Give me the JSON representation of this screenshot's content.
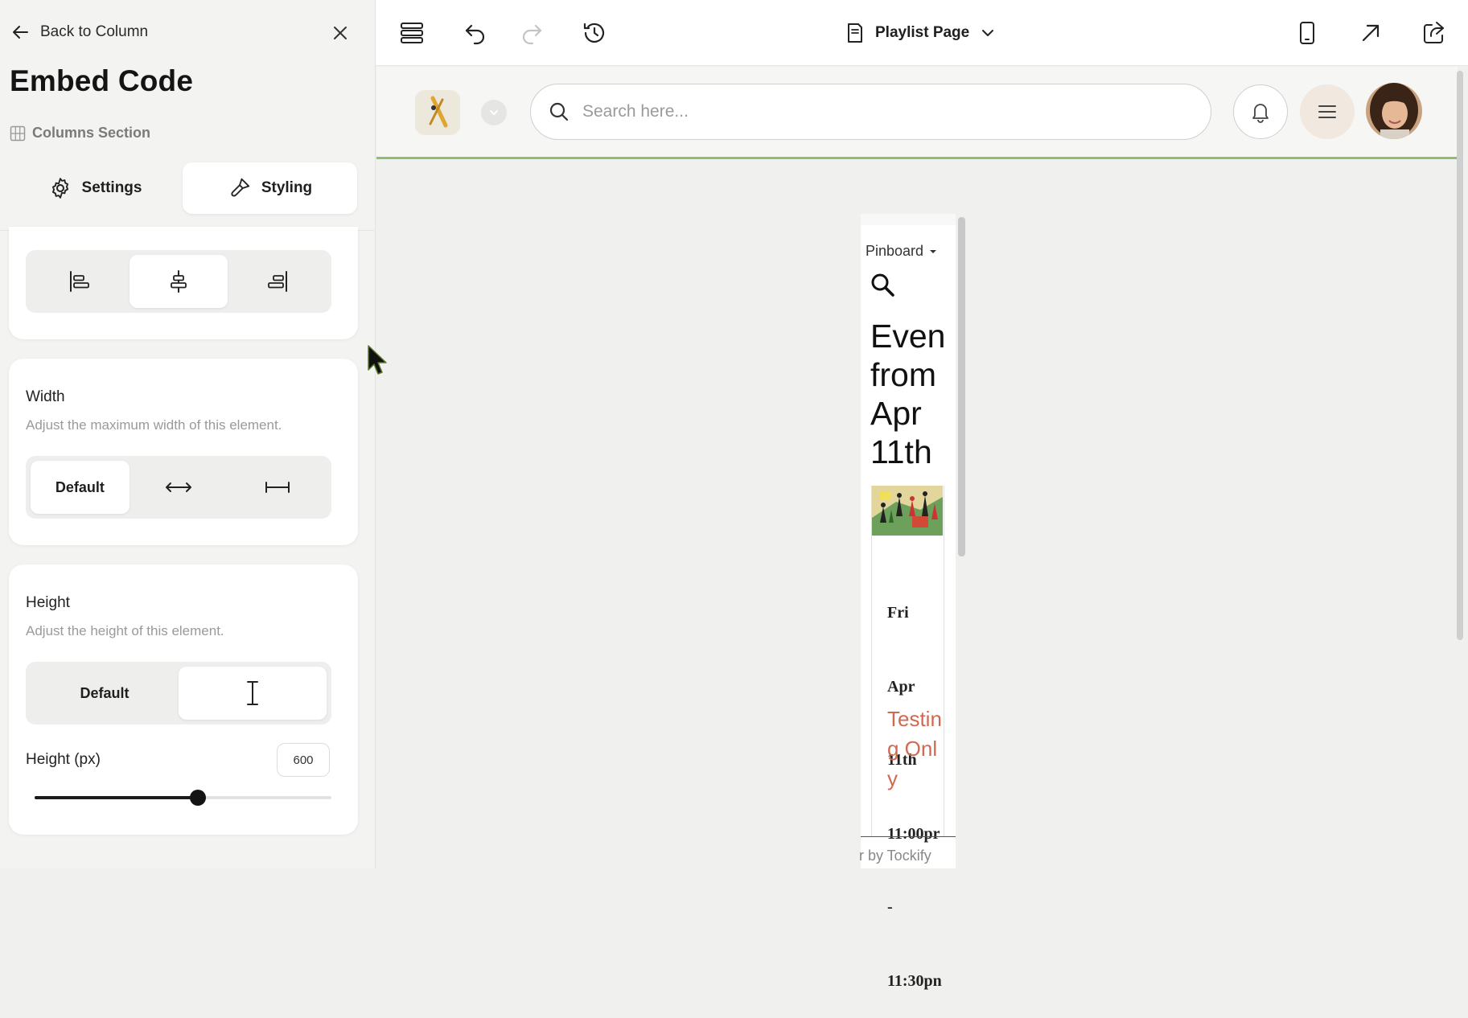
{
  "left_panel": {
    "back_label": "Back to Column",
    "title": "Embed Code",
    "section_label": "Columns Section",
    "tabs": [
      {
        "label": "Settings",
        "icon": "gear-icon"
      },
      {
        "label": "Styling",
        "icon": "paintbrush-icon",
        "active": true
      }
    ],
    "alignment": {
      "options": [
        "align-left-icon",
        "align-center-icon",
        "align-right-icon"
      ],
      "selected": "align-center-icon"
    },
    "width": {
      "label": "Width",
      "description": "Adjust the maximum width of this element.",
      "options": [
        "Default",
        "full-width-icon",
        "fixed-width-icon"
      ],
      "default_label": "Default",
      "selected": "Default"
    },
    "height": {
      "label": "Height",
      "description": "Adjust the height of this element.",
      "default_label": "Default",
      "selected": "text-cursor-icon",
      "px_label": "Height (px)",
      "px_value": "600",
      "slider_fraction": 0.55
    }
  },
  "toolbar": {
    "page_name": "Playlist Page",
    "icons": [
      "layers-icon",
      "undo-icon",
      "redo-icon",
      "history-icon",
      "page-icon",
      "chevron-down-icon",
      "mobile-preview-icon",
      "open-external-icon",
      "share-icon"
    ]
  },
  "site_header": {
    "search_placeholder": "Search here...",
    "accent_color": "#8fbf6e"
  },
  "widget": {
    "view_label": "Pinboard",
    "heading": "Even\nfrom\nApr\n11th",
    "heading_lines": [
      "Even",
      "from",
      "Apr",
      "11th"
    ],
    "date_lines": [
      "Fri",
      "Apr",
      "11th",
      "11:00pr",
      "-",
      "11:30pn"
    ],
    "event_title": "Testing Only",
    "powered_by": "r by Tockify",
    "title_color": "#cf6a52"
  }
}
